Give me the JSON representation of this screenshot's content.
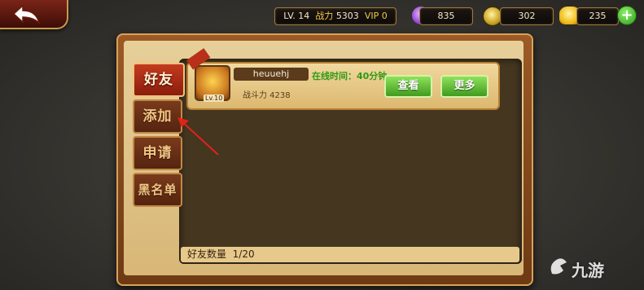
{
  "top_bar": {
    "level_label": "LV. 14",
    "power_label": "战力",
    "power_value": "5303",
    "vip_label": "VIP 0",
    "crystal_value": "835",
    "coin_value": "302",
    "gold_value": "235",
    "plus": "+"
  },
  "tabs": [
    {
      "label": "好友"
    },
    {
      "label": "添加"
    },
    {
      "label": "申请"
    },
    {
      "label": "黑名单"
    }
  ],
  "friend": {
    "level": "Lv.10",
    "name": "heuuehj",
    "online": "在线时间：40分钟",
    "power": "战斗力  4238",
    "view_label": "查看",
    "more_label": "更多"
  },
  "footer": {
    "count_label": "好友数量",
    "count_value": "1/20"
  },
  "watermark": "九游",
  "colors": {
    "accent_red": "#b8301a",
    "tab_active": "#c43b1e",
    "button_green": "#3f9b1f",
    "arrow_red": "#e0231a"
  }
}
